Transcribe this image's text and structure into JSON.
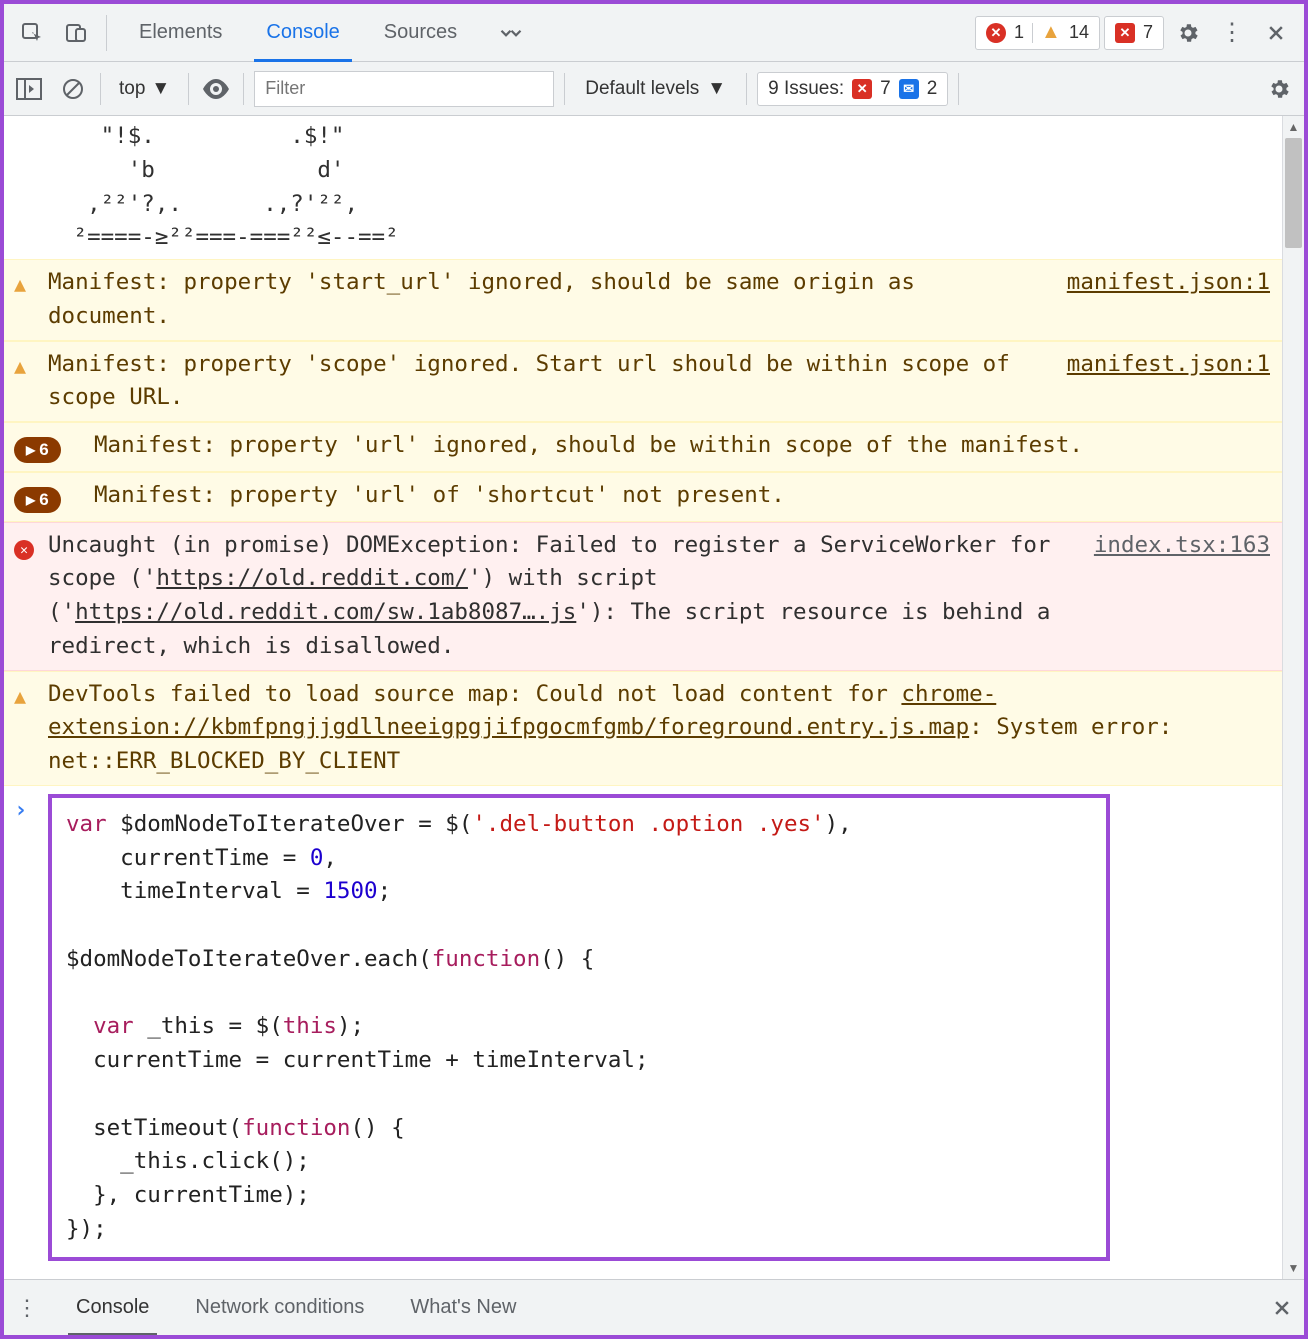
{
  "topbar": {
    "tabs": {
      "elements": "Elements",
      "console": "Console",
      "sources": "Sources"
    },
    "errors": "1",
    "warnings": "14",
    "msg_errors": "7"
  },
  "toolbar": {
    "context": "top",
    "filter_placeholder": "Filter",
    "levels": "Default levels",
    "issues_label": "9 Issues:",
    "issues_err": "7",
    "issues_info": "2"
  },
  "ascii": "   \"!$.          .$!\"\n     'b            d'\n  ,²²'?,.      .,?'²²,\n ²====-≥²²===-===²²≤--==²",
  "messages": [
    {
      "type": "warn",
      "text": "Manifest: property 'start_url' ignored, should be same origin as document.",
      "src": "manifest.json:1"
    },
    {
      "type": "warn",
      "text": "Manifest: property 'scope' ignored. Start url should be within scope of scope URL.",
      "src": "manifest.json:1"
    },
    {
      "type": "warn",
      "pill": "6",
      "text": "Manifest: property 'url' ignored, should be within scope of the manifest.",
      "src": ""
    },
    {
      "type": "warn",
      "pill": "6",
      "text": "Manifest: property 'url' of 'shortcut' not present.",
      "src": ""
    },
    {
      "type": "err",
      "src": "index.tsx:163",
      "segments": [
        {
          "t": "Uncaught (in promise) DOMException: Failed to register a ServiceWorker for scope ('"
        },
        {
          "t": "https://old.reddit.com/",
          "u": true
        },
        {
          "t": "') with script ('"
        },
        {
          "t": "https://old.reddit.com/sw.1ab8087….js",
          "u": true
        },
        {
          "t": "'): The script resource is behind a redirect, which is disallowed."
        }
      ]
    },
    {
      "type": "warn",
      "src": "",
      "segments": [
        {
          "t": "DevTools failed to load source map: Could not load content for "
        },
        {
          "t": "chrome-extension://kbmfpngjjgdllneeigpgjifpgocmfgmb/foreground.entry.js.map",
          "u": true
        },
        {
          "t": ": System error: net::ERR_BLOCKED_BY_CLIENT"
        }
      ]
    }
  ],
  "input_code": {
    "l1a": "var",
    "l1b": " $domNodeToIterateOver = $(",
    "l1c": "'.del-button .option .yes'",
    "l1d": "),",
    "l2a": "    currentTime = ",
    "l2b": "0",
    "l2c": ",",
    "l3a": "    timeInterval = ",
    "l3b": "1500",
    "l3c": ";",
    "l5": "$domNodeToIterateOver.each(",
    "l5b": "function",
    "l5c": "() {",
    "l7a": "  var",
    "l7b": " _this = $(",
    "l7c": "this",
    "l7d": ");",
    "l8": "  currentTime = currentTime + timeInterval;",
    "l10a": "  setTimeout(",
    "l10b": "function",
    "l10c": "() {",
    "l11": "    _this.click();",
    "l12": "  }, currentTime);",
    "l13": "});"
  },
  "footer": {
    "console": "Console",
    "network": "Network conditions",
    "whatsnew": "What's New"
  }
}
